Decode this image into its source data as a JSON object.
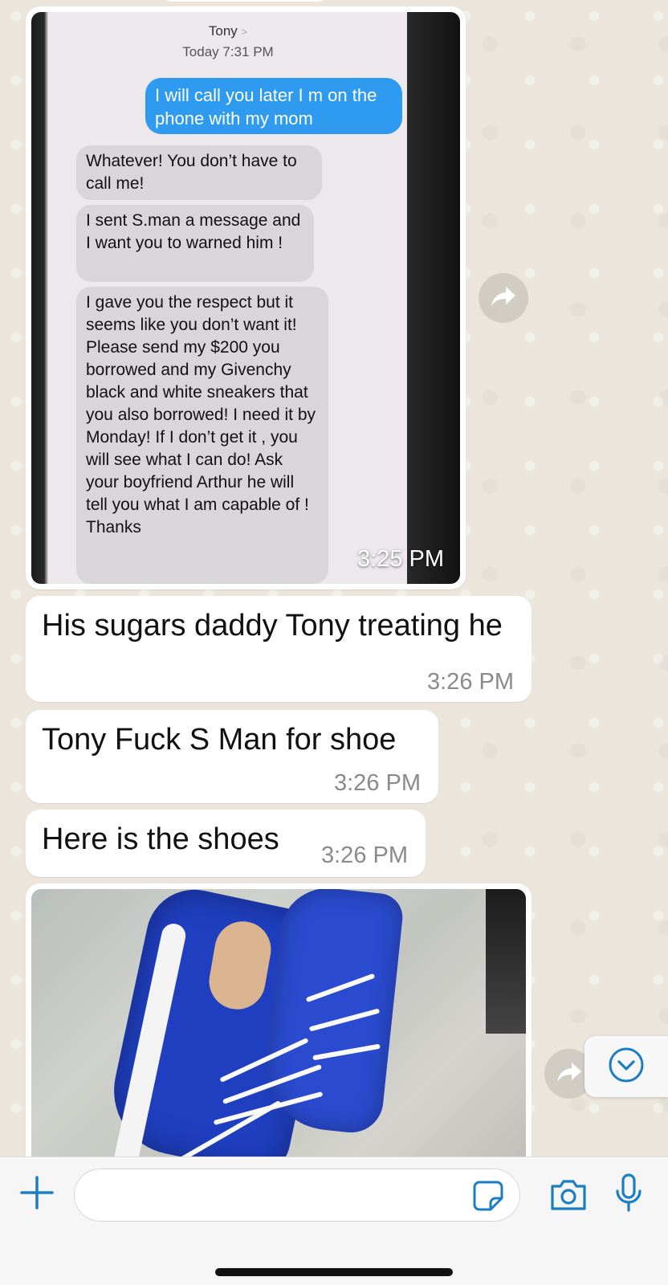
{
  "screenshot": {
    "contact": "Tony",
    "contact_chevron": ">",
    "date": "Today 7:31 PM",
    "sent_message": "I will call you later I m on the phone with my mom",
    "received_messages": [
      "Whatever! You don’t have to call me!",
      "I sent S.man a message and I want you to warned him !",
      "I gave you the respect but it seems like you don’t want it! Please send my $200 you borrowed and my Givenchy black and white sneakers that you also borrowed! I need it by Monday! If I don’t get it , you will see what I can do! Ask your boyfriend Arthur he will tell you what I am capable of ! Thanks"
    ]
  },
  "messages": [
    {
      "type": "image",
      "time": "3:25 PM"
    },
    {
      "type": "text",
      "text": "His sugars daddy  Tony treating he",
      "time": "3:26 PM"
    },
    {
      "type": "text",
      "text": "Tony Fuck S Man for shoe",
      "time": "3:26 PM"
    },
    {
      "type": "text",
      "text": "Here is the shoes",
      "time": "3:26 PM"
    },
    {
      "type": "image",
      "time": ""
    }
  ],
  "icons": {
    "forward": "forward-arrow-icon",
    "scroll_down": "chevron-down-circle-icon",
    "plus": "plus-icon",
    "sticker": "sticker-icon",
    "camera": "camera-icon",
    "mic": "microphone-icon"
  },
  "colors": {
    "accent": "#1c7ec2",
    "wallpaper": "#ebe5dc",
    "bubble": "#ffffff",
    "imessage_blue": "#2e9bf0"
  },
  "composer": {
    "placeholder": ""
  }
}
